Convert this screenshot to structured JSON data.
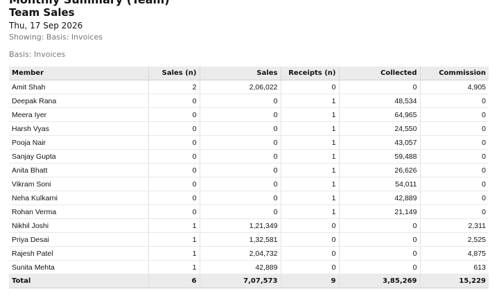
{
  "report": {
    "cut_heading": "Monthly Summary (Team)",
    "title": "Team Sales",
    "date": "Thu, 17 Sep 2026",
    "showing": "Showing: Basis: Invoices",
    "basis": "Basis: Invoices"
  },
  "table": {
    "headers": [
      "Member",
      "Sales (n)",
      "Sales",
      "Receipts (n)",
      "Collected",
      "Commission"
    ],
    "align": [
      "l",
      "r",
      "r",
      "r",
      "r",
      "r"
    ],
    "rows": [
      [
        "Amit Shah",
        "2",
        "2,06,022",
        "0",
        "0",
        "4,905"
      ],
      [
        "Deepak Rana",
        "0",
        "0",
        "1",
        "48,534",
        "0"
      ],
      [
        "Meera Iyer",
        "0",
        "0",
        "1",
        "64,965",
        "0"
      ],
      [
        "Harsh Vyas",
        "0",
        "0",
        "1",
        "24,550",
        "0"
      ],
      [
        "Pooja Nair",
        "0",
        "0",
        "1",
        "43,057",
        "0"
      ],
      [
        "Sanjay Gupta",
        "0",
        "0",
        "1",
        "59,488",
        "0"
      ],
      [
        "Anita Bhatt",
        "0",
        "0",
        "1",
        "26,626",
        "0"
      ],
      [
        "Vikram Soni",
        "0",
        "0",
        "1",
        "54,011",
        "0"
      ],
      [
        "Neha Kulkarni",
        "0",
        "0",
        "1",
        "42,889",
        "0"
      ],
      [
        "Rohan Verma",
        "0",
        "0",
        "1",
        "21,149",
        "0"
      ],
      [
        "Nikhil Joshi",
        "1",
        "1,21,349",
        "0",
        "0",
        "2,311"
      ],
      [
        "Priya Desai",
        "1",
        "1,32,581",
        "0",
        "0",
        "2,525"
      ],
      [
        "Rajesh Patel",
        "1",
        "2,04,732",
        "0",
        "0",
        "4,875"
      ],
      [
        "Sunita Mehta",
        "1",
        "42,889",
        "0",
        "0",
        "613"
      ]
    ],
    "total": [
      "Total",
      "6",
      "7,07,573",
      "9",
      "3,85,269",
      "15,229"
    ]
  }
}
